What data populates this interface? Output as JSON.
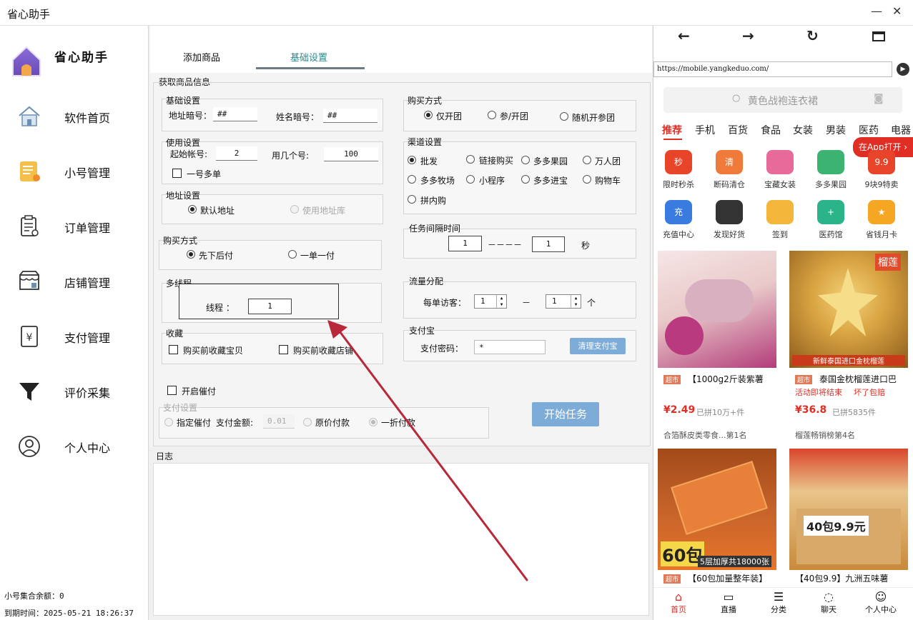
{
  "window": {
    "title": "省心助手"
  },
  "sidebar": {
    "brand": "省心助手",
    "items": [
      {
        "label": "软件首页",
        "icon": "home-icon"
      },
      {
        "label": "小号管理",
        "icon": "notebook-icon"
      },
      {
        "label": "订单管理",
        "icon": "order-icon"
      },
      {
        "label": "店铺管理",
        "icon": "store-icon"
      },
      {
        "label": "支付管理",
        "icon": "payment-icon"
      },
      {
        "label": "评价采集",
        "icon": "filter-icon"
      },
      {
        "label": "个人中心",
        "icon": "user-icon"
      }
    ],
    "balance": "小号集合余额：0",
    "expire_label": "到期时间：",
    "expire_value": "2025-05-21 18:26:37"
  },
  "tabs": [
    {
      "label": "添加商品"
    },
    {
      "label": "基础设置"
    }
  ],
  "form": {
    "section": "获取商品信息",
    "basic": {
      "title": "基础设置",
      "addr_code_label": "地址暗号：",
      "addr_code": "##",
      "name_code_label": "姓名暗号：",
      "name_code": "##"
    },
    "usage": {
      "title": "使用设置",
      "start_label": "起始帐号:",
      "start": "2",
      "count_label": "用几个号:",
      "count": "100",
      "multi_label": "一号多单"
    },
    "address": {
      "title": "地址设置",
      "default": "默认地址",
      "library": "使用地址库"
    },
    "buy_mode": {
      "title": "购买方式",
      "first": "先下后付",
      "single": "一单一付"
    },
    "thread": {
      "title": "多线程",
      "label": "线程 ：",
      "value": "1"
    },
    "favorite": {
      "title": "收藏",
      "item": "购买前收藏宝贝",
      "shop": "购买前收藏店铺"
    },
    "urge": {
      "label": "开启催付"
    },
    "pay": {
      "title": "支付设置",
      "assign": "指定催付",
      "amount_label": "支付金额:",
      "amount": "0.01",
      "original": "原价付款",
      "discount": "一折付款"
    },
    "purchase": {
      "title": "购买方式",
      "opt1": "仅开团",
      "opt2": "参/开团",
      "opt3": "随机开参团"
    },
    "channel": {
      "title": "渠道设置",
      "options": [
        "批发",
        "链接购买",
        "多多果园",
        "万人团",
        "多多牧场",
        "小程序",
        "多多进宝",
        "购物车",
        "拼内购"
      ]
    },
    "interval": {
      "title": "任务间隔时间",
      "from": "1",
      "dash": "－－－－",
      "to": "1",
      "unit": "秒"
    },
    "traffic": {
      "title": "流量分配",
      "label": "每单访客：",
      "from": "1",
      "dash": "－",
      "to": "1",
      "unit": "个"
    },
    "alipay": {
      "title": "支付宝",
      "pwd_label": "支付密码：",
      "pwd": "*",
      "clear": "清理支付宝"
    },
    "start": "开始任务"
  },
  "log": {
    "title": "日志"
  },
  "browser": {
    "url": "https://mobile.yangkeduo.com/",
    "search_placeholder": "黄色战袍连衣裙",
    "categories": [
      "推荐",
      "手机",
      "百货",
      "食品",
      "女装",
      "男装",
      "医药",
      "电器"
    ],
    "open_app": "在App打开",
    "icons": [
      {
        "label": "限时秒杀",
        "color": "#e8442a",
        "text": "秒"
      },
      {
        "label": "断码清仓",
        "color": "#f07a3a",
        "text": "清"
      },
      {
        "label": "宝藏女装",
        "color": "#e86a9a",
        "text": ""
      },
      {
        "label": "多多果园",
        "color": "#3cb371",
        "text": ""
      },
      {
        "label": "9块9特卖",
        "color": "#e8442a",
        "text": "9.9"
      },
      {
        "label": "充值中心",
        "color": "#3a7be0",
        "text": "充"
      },
      {
        "label": "发现好货",
        "color": "#333333",
        "text": ""
      },
      {
        "label": "签到",
        "color": "#f3b63a",
        "text": ""
      },
      {
        "label": "医药馆",
        "color": "#2bb38a",
        "text": "+"
      },
      {
        "label": "省钱月卡",
        "color": "#f5a623",
        "text": "★"
      }
    ],
    "products": [
      {
        "tag": "超市",
        "title": "【1000g2斤装紫薯",
        "price": "¥2.49",
        "sold": "已拼10万+件",
        "rank": "合箔酥皮类零食...第1名",
        "img_top": "#f3d9d9",
        "img_bottom": "#b33c7a",
        "label": ""
      },
      {
        "tag": "超市",
        "title": "泰国金枕榴莲进口巴",
        "sub": "活动即将结束",
        "sub2": "坏了包赔",
        "price": "¥36.8",
        "sold": "已拼5835件",
        "rank": "榴莲畅销榜第4名",
        "img_top": "#d9a442",
        "img_bottom": "#8b5a1a",
        "label": "榴莲",
        "banner": "新鲜泰国进口金枕榴莲"
      },
      {
        "tag": "超市",
        "title": "【60包加量整年装】",
        "banner": "5层加厚共18000张",
        "big": "60包",
        "img_top": "#c5632a",
        "img_bottom": "#e8742a"
      },
      {
        "title": "【40包9.9】九洲五味薯",
        "big": "40包9.9元",
        "img_top": "#e9c48a",
        "img_bottom": "#c98a3a"
      }
    ],
    "bottom_nav": [
      "首页",
      "直播",
      "分类",
      "聊天",
      "个人中心"
    ]
  }
}
